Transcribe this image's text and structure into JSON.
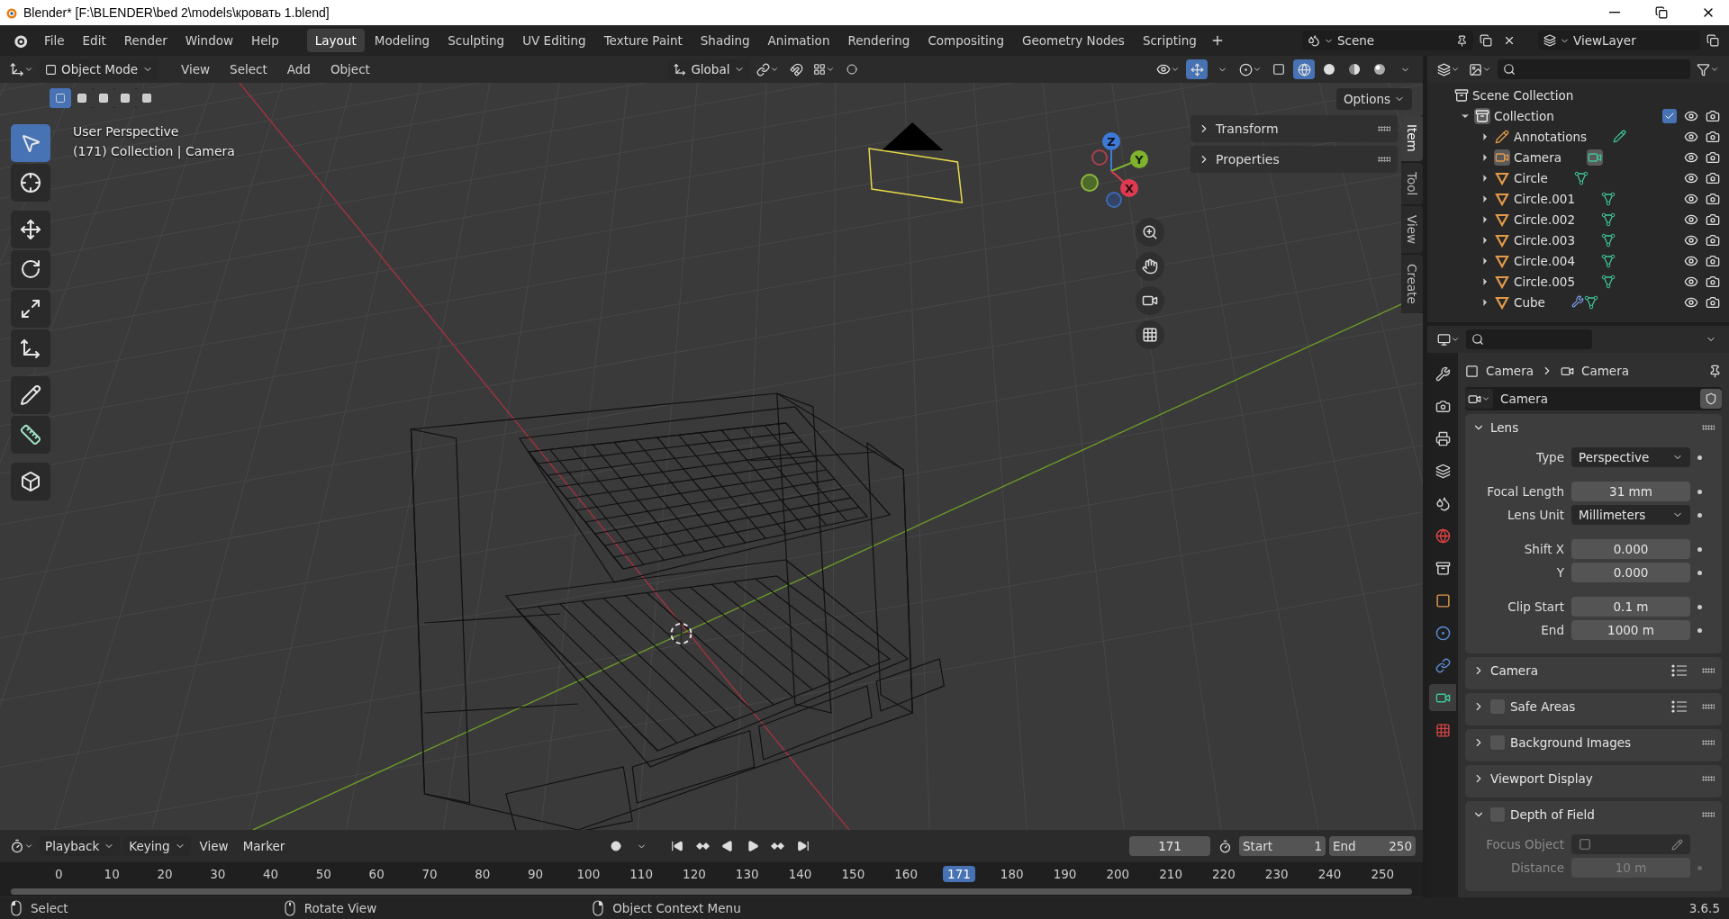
{
  "window": {
    "title": "Blender* [F:\\BLENDER\\bed 2\\models\\кровать 1.blend]"
  },
  "menu": [
    "File",
    "Edit",
    "Render",
    "Window",
    "Help"
  ],
  "workspaces": [
    {
      "label": "Layout",
      "selected": true
    },
    {
      "label": "Modeling",
      "selected": false
    },
    {
      "label": "Sculpting",
      "selected": false
    },
    {
      "label": "UV Editing",
      "selected": false
    },
    {
      "label": "Texture Paint",
      "selected": false
    },
    {
      "label": "Shading",
      "selected": false
    },
    {
      "label": "Animation",
      "selected": false
    },
    {
      "label": "Rendering",
      "selected": false
    },
    {
      "label": "Compositing",
      "selected": false
    },
    {
      "label": "Geometry Nodes",
      "selected": false
    },
    {
      "label": "Scripting",
      "selected": false
    }
  ],
  "scene": "Scene",
  "view_layer": "ViewLayer",
  "viewport": {
    "mode": "Object Mode",
    "menus": [
      "View",
      "Select",
      "Add",
      "Object"
    ],
    "orientation": "Global",
    "options": "Options",
    "select_modes": [
      {
        "selected": true
      },
      {
        "selected": false
      },
      {
        "selected": false
      },
      {
        "selected": false
      },
      {
        "selected": false
      }
    ],
    "tools": [
      {
        "kind": "select",
        "selected": true
      },
      {
        "kind": "cursor",
        "selected": false
      },
      {
        "kind": "move",
        "selected": false
      },
      {
        "kind": "rotate",
        "selected": false
      },
      {
        "kind": "scale",
        "selected": false
      },
      {
        "kind": "transform",
        "selected": false
      },
      {
        "kind": "annotate",
        "selected": false
      },
      {
        "kind": "measure",
        "selected": false
      },
      {
        "kind": "add_cube",
        "selected": false
      }
    ],
    "shading": [
      {
        "kind": "wireframe",
        "selected": true
      },
      {
        "kind": "solid",
        "selected": false
      },
      {
        "kind": "material",
        "selected": false
      },
      {
        "kind": "rendered",
        "selected": false
      }
    ],
    "overlay_text": [
      "User Perspective",
      "(171) Collection | Camera"
    ],
    "gizmo_axes": [
      "Z",
      "Y",
      "X"
    ],
    "sidebar_panels": [
      {
        "title": "Transform",
        "expanded": false
      },
      {
        "title": "Properties",
        "expanded": false
      }
    ],
    "sidebar_tabs": [
      {
        "label": "Item",
        "selected": true
      },
      {
        "label": "Tool",
        "selected": false
      },
      {
        "label": "View",
        "selected": false
      },
      {
        "label": "Create",
        "selected": false
      }
    ]
  },
  "outliner": {
    "tree": [
      {
        "name": "Scene Collection",
        "kind": "scene",
        "children": [
          {
            "name": "Collection",
            "kind": "collection",
            "expanded": true,
            "checked": true,
            "children": [
              {
                "name": "Annotations",
                "kind": "annotation",
                "expanded": false,
                "active": false
              },
              {
                "name": "Camera",
                "kind": "camera",
                "expanded": false,
                "active": true
              },
              {
                "name": "Circle",
                "kind": "mesh",
                "expanded": false,
                "active": false
              },
              {
                "name": "Circle.001",
                "kind": "mesh",
                "expanded": false,
                "active": false
              },
              {
                "name": "Circle.002",
                "kind": "mesh",
                "expanded": false,
                "active": false
              },
              {
                "name": "Circle.003",
                "kind": "mesh",
                "expanded": false,
                "active": false
              },
              {
                "name": "Circle.004",
                "kind": "mesh",
                "expanded": false,
                "active": false
              },
              {
                "name": "Circle.005",
                "kind": "mesh",
                "expanded": false,
                "active": false
              },
              {
                "name": "Cube",
                "kind": "mesh_modifier",
                "expanded": false,
                "active": false
              }
            ]
          }
        ]
      }
    ]
  },
  "properties": {
    "tabs": [
      {
        "kind": "tool",
        "selected": false
      },
      {
        "kind": "render",
        "selected": false
      },
      {
        "kind": "output",
        "selected": false
      },
      {
        "kind": "view_layer",
        "selected": false
      },
      {
        "kind": "scene",
        "selected": false
      },
      {
        "kind": "world",
        "selected": false
      },
      {
        "kind": "collection",
        "selected": false
      },
      {
        "kind": "object",
        "selected": false
      },
      {
        "kind": "physics",
        "selected": false
      },
      {
        "kind": "constraints",
        "selected": false
      },
      {
        "kind": "data",
        "selected": true
      },
      {
        "kind": "texture",
        "selected": false
      }
    ],
    "breadcrumb": [
      "Camera",
      "Camera"
    ],
    "datablock": "Camera",
    "panels": [
      {
        "title": "Lens",
        "expanded": true,
        "groups": [
          [
            {
              "label": "Type",
              "value": "Perspective",
              "kind": "dropdown",
              "disabled": false
            }
          ],
          [
            {
              "label": "Focal Length",
              "value": "31 mm",
              "kind": "number",
              "disabled": false
            },
            {
              "label": "Lens Unit",
              "value": "Millimeters",
              "kind": "dropdown",
              "disabled": false
            }
          ],
          [
            {
              "label": "Shift X",
              "value": "0.000",
              "kind": "number",
              "disabled": false
            },
            {
              "label": "Y",
              "value": "0.000",
              "kind": "number",
              "disabled": false
            }
          ],
          [
            {
              "label": "Clip Start",
              "value": "0.1 m",
              "kind": "number",
              "disabled": false
            },
            {
              "label": "End",
              "value": "1000 m",
              "kind": "number",
              "disabled": false
            }
          ]
        ]
      },
      {
        "title": "Camera",
        "expanded": false,
        "presets": true
      },
      {
        "title": "Safe Areas",
        "expanded": false,
        "checked": false,
        "presets": true
      },
      {
        "title": "Background Images",
        "expanded": false,
        "checked": false,
        "presets": false
      },
      {
        "title": "Viewport Display",
        "expanded": false,
        "presets": false
      },
      {
        "title": "Depth of Field",
        "expanded": true,
        "checked": false,
        "presets": false,
        "groups": [
          [
            {
              "label": "Focus Object",
              "kind": "object",
              "disabled": true
            },
            {
              "label": "Distance",
              "value": "10 m",
              "kind": "number",
              "disabled": true
            }
          ]
        ]
      }
    ]
  },
  "timeline": {
    "menus": [
      {
        "label": "Playback",
        "dropdown": true
      },
      {
        "label": "Keying",
        "dropdown": true
      },
      {
        "label": "View",
        "dropdown": false
      },
      {
        "label": "Marker",
        "dropdown": false
      }
    ],
    "current_frame": "171",
    "start_label": "Start",
    "start": "1",
    "end_label": "End",
    "end": "250",
    "ruler": [
      {
        "label": "0",
        "selected": false
      },
      {
        "label": "10",
        "selected": false
      },
      {
        "label": "20",
        "selected": false
      },
      {
        "label": "30",
        "selected": false
      },
      {
        "label": "40",
        "selected": false
      },
      {
        "label": "50",
        "selected": false
      },
      {
        "label": "60",
        "selected": false
      },
      {
        "label": "70",
        "selected": false
      },
      {
        "label": "80",
        "selected": false
      },
      {
        "label": "90",
        "selected": false
      },
      {
        "label": "100",
        "selected": false
      },
      {
        "label": "110",
        "selected": false
      },
      {
        "label": "120",
        "selected": false
      },
      {
        "label": "130",
        "selected": false
      },
      {
        "label": "140",
        "selected": false
      },
      {
        "label": "150",
        "selected": false
      },
      {
        "label": "160",
        "selected": false
      },
      {
        "label": "171",
        "selected": true
      },
      {
        "label": "180",
        "selected": false
      },
      {
        "label": "190",
        "selected": false
      },
      {
        "label": "200",
        "selected": false
      },
      {
        "label": "210",
        "selected": false
      },
      {
        "label": "220",
        "selected": false
      },
      {
        "label": "230",
        "selected": false
      },
      {
        "label": "240",
        "selected": false
      },
      {
        "label": "250",
        "selected": false
      }
    ]
  },
  "status_bar": {
    "hints": [
      {
        "kind": "left",
        "label": "Select"
      },
      {
        "kind": "middle",
        "label": "Rotate View"
      },
      {
        "kind": "right",
        "label": "Object Context Menu"
      }
    ],
    "version": "3.6.5"
  }
}
